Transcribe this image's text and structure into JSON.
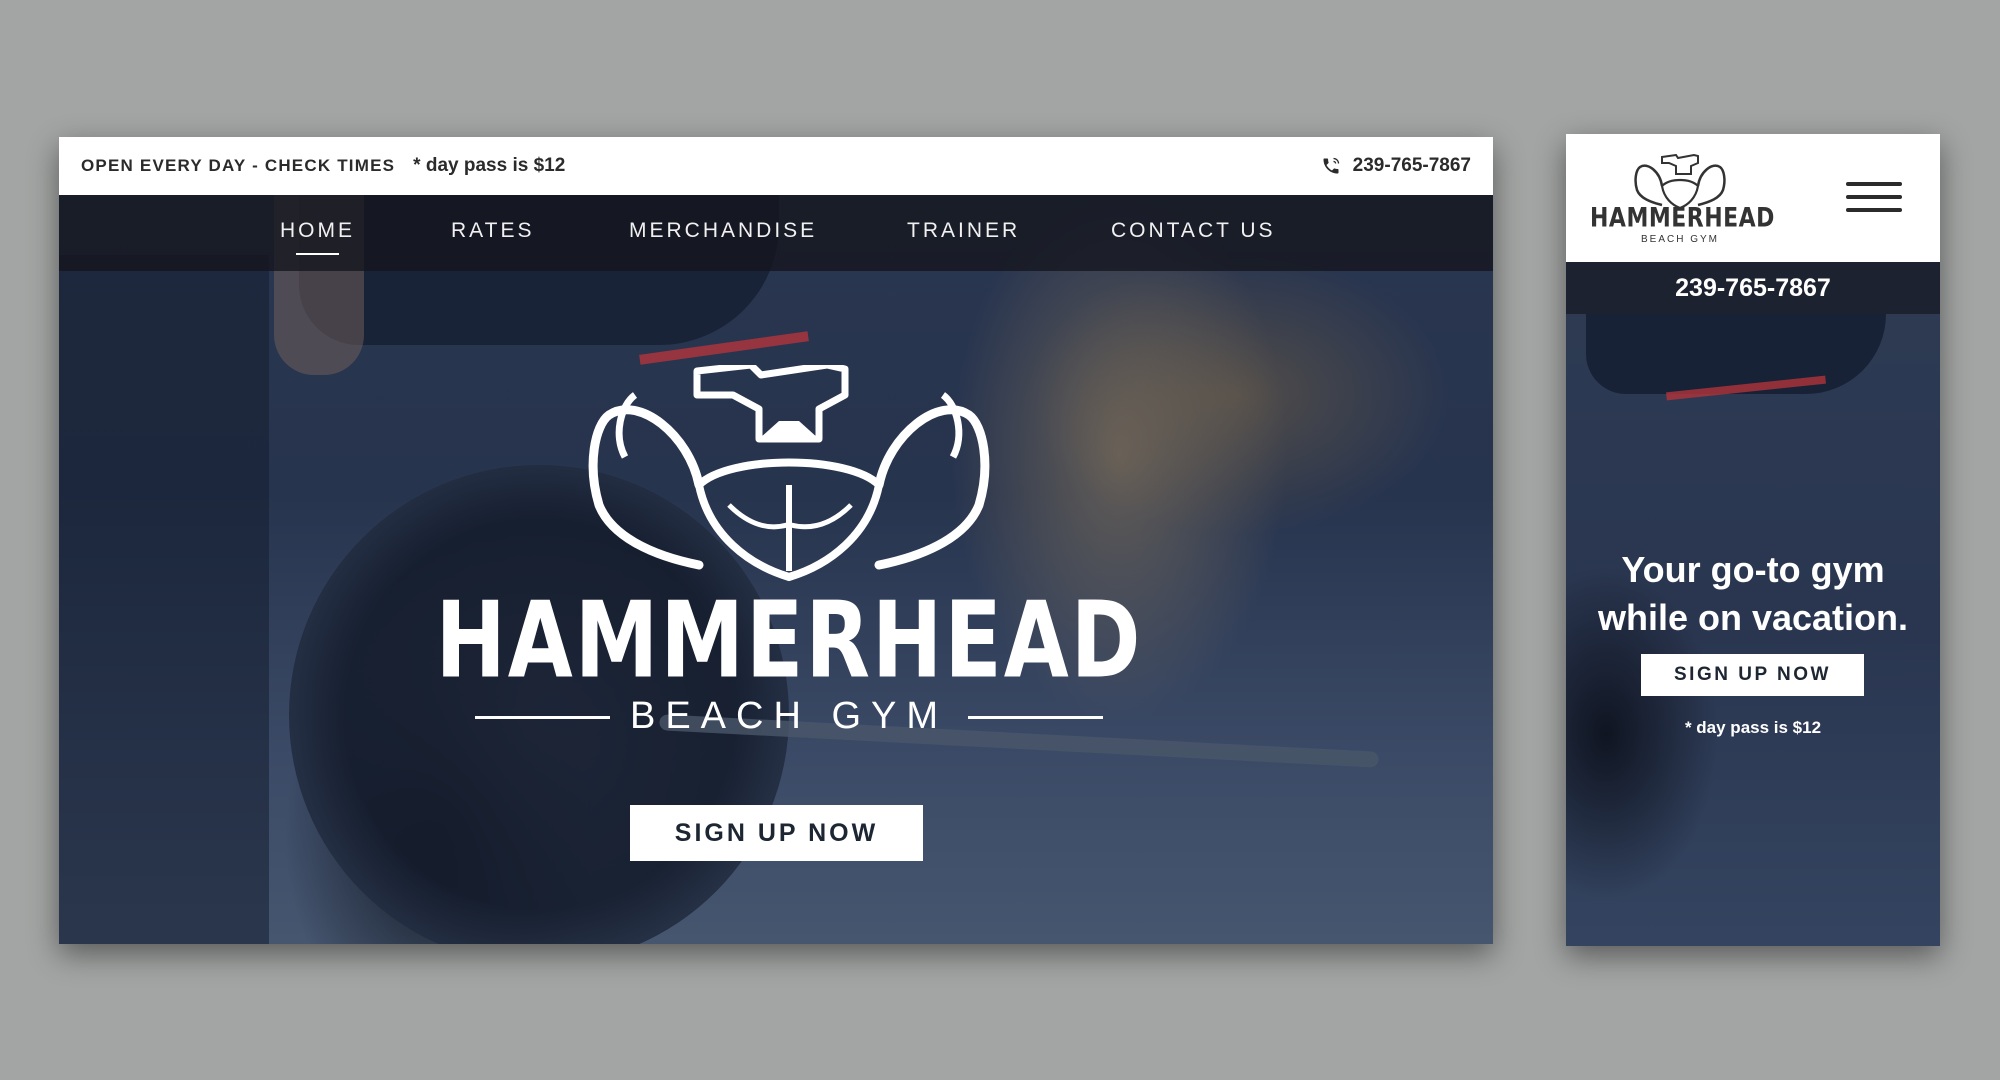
{
  "desktop": {
    "topbar": {
      "hours": "OPEN EVERY DAY - CHECK TIMES",
      "day_pass": "* day pass is $12",
      "phone": "239-765-7867",
      "phone_icon": "phone-icon"
    },
    "nav": {
      "items": [
        {
          "label": "HOME",
          "active": true
        },
        {
          "label": "RATES",
          "active": false
        },
        {
          "label": "MERCHANDISE",
          "active": false
        },
        {
          "label": "TRAINER",
          "active": false
        },
        {
          "label": "CONTACT US",
          "active": false
        }
      ]
    },
    "hero": {
      "brand_name": "HAMMERHEAD",
      "brand_sub": "BEACH GYM",
      "cta": "SIGN UP NOW"
    }
  },
  "mobile": {
    "logo_name": "HAMMERHEAD",
    "logo_sub": "BEACH GYM",
    "menu_icon": "hamburger-menu-icon",
    "phone": "239-765-7867",
    "tagline_line1": "Your go-to gym",
    "tagline_line2": "while on vacation.",
    "cta": "SIGN UP NOW",
    "day_pass": "* day pass is $12"
  },
  "colors": {
    "page_bg": "#a3a5a4",
    "hero_overlay": "#1f2d45",
    "nav_bg": "#14161e",
    "accent_red": "#b2343b",
    "button_bg": "#ffffff",
    "button_text": "#1d2633"
  }
}
